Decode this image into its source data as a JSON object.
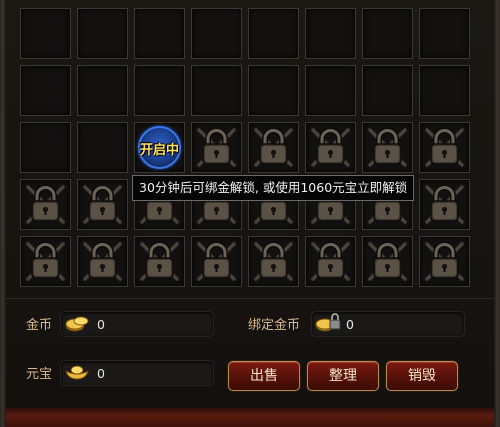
{
  "inventory": {
    "opening_slot_label": "开启中",
    "tooltip": "30分钟后可绑金解锁, 或使用1060元宝立即解锁",
    "slots": [
      "empty",
      "empty",
      "empty",
      "empty",
      "empty",
      "empty",
      "empty",
      "empty",
      "empty",
      "empty",
      "empty",
      "empty",
      "empty",
      "empty",
      "empty",
      "empty",
      "empty",
      "empty",
      "opening",
      "locked",
      "locked",
      "locked",
      "locked",
      "locked",
      "locked",
      "locked",
      "locked",
      "locked",
      "locked",
      "locked",
      "locked",
      "locked",
      "locked",
      "locked",
      "locked",
      "locked",
      "locked",
      "locked",
      "locked",
      "locked"
    ]
  },
  "currency": {
    "gold_label": "金币",
    "gold_value": "0",
    "bound_gold_label": "绑定金币",
    "bound_gold_value": "0",
    "yuanbao_label": "元宝",
    "yuanbao_value": "0"
  },
  "actions": {
    "sell_label": "出售",
    "sort_label": "整理",
    "destroy_label": "销毁"
  },
  "colors": {
    "label": "#d7b88a",
    "button": "#55110a",
    "button_border": "#b48a4f",
    "opening_ring": "#3b76e0",
    "opening_text": "#ffe06b"
  },
  "icons": {
    "locked_slot": "padlock-icon",
    "opening_slot": "unlocking-icon",
    "gold": "gold-coin-icon",
    "bound_gold": "bound-gold-icon",
    "yuanbao": "yuanbao-ingot-icon"
  }
}
